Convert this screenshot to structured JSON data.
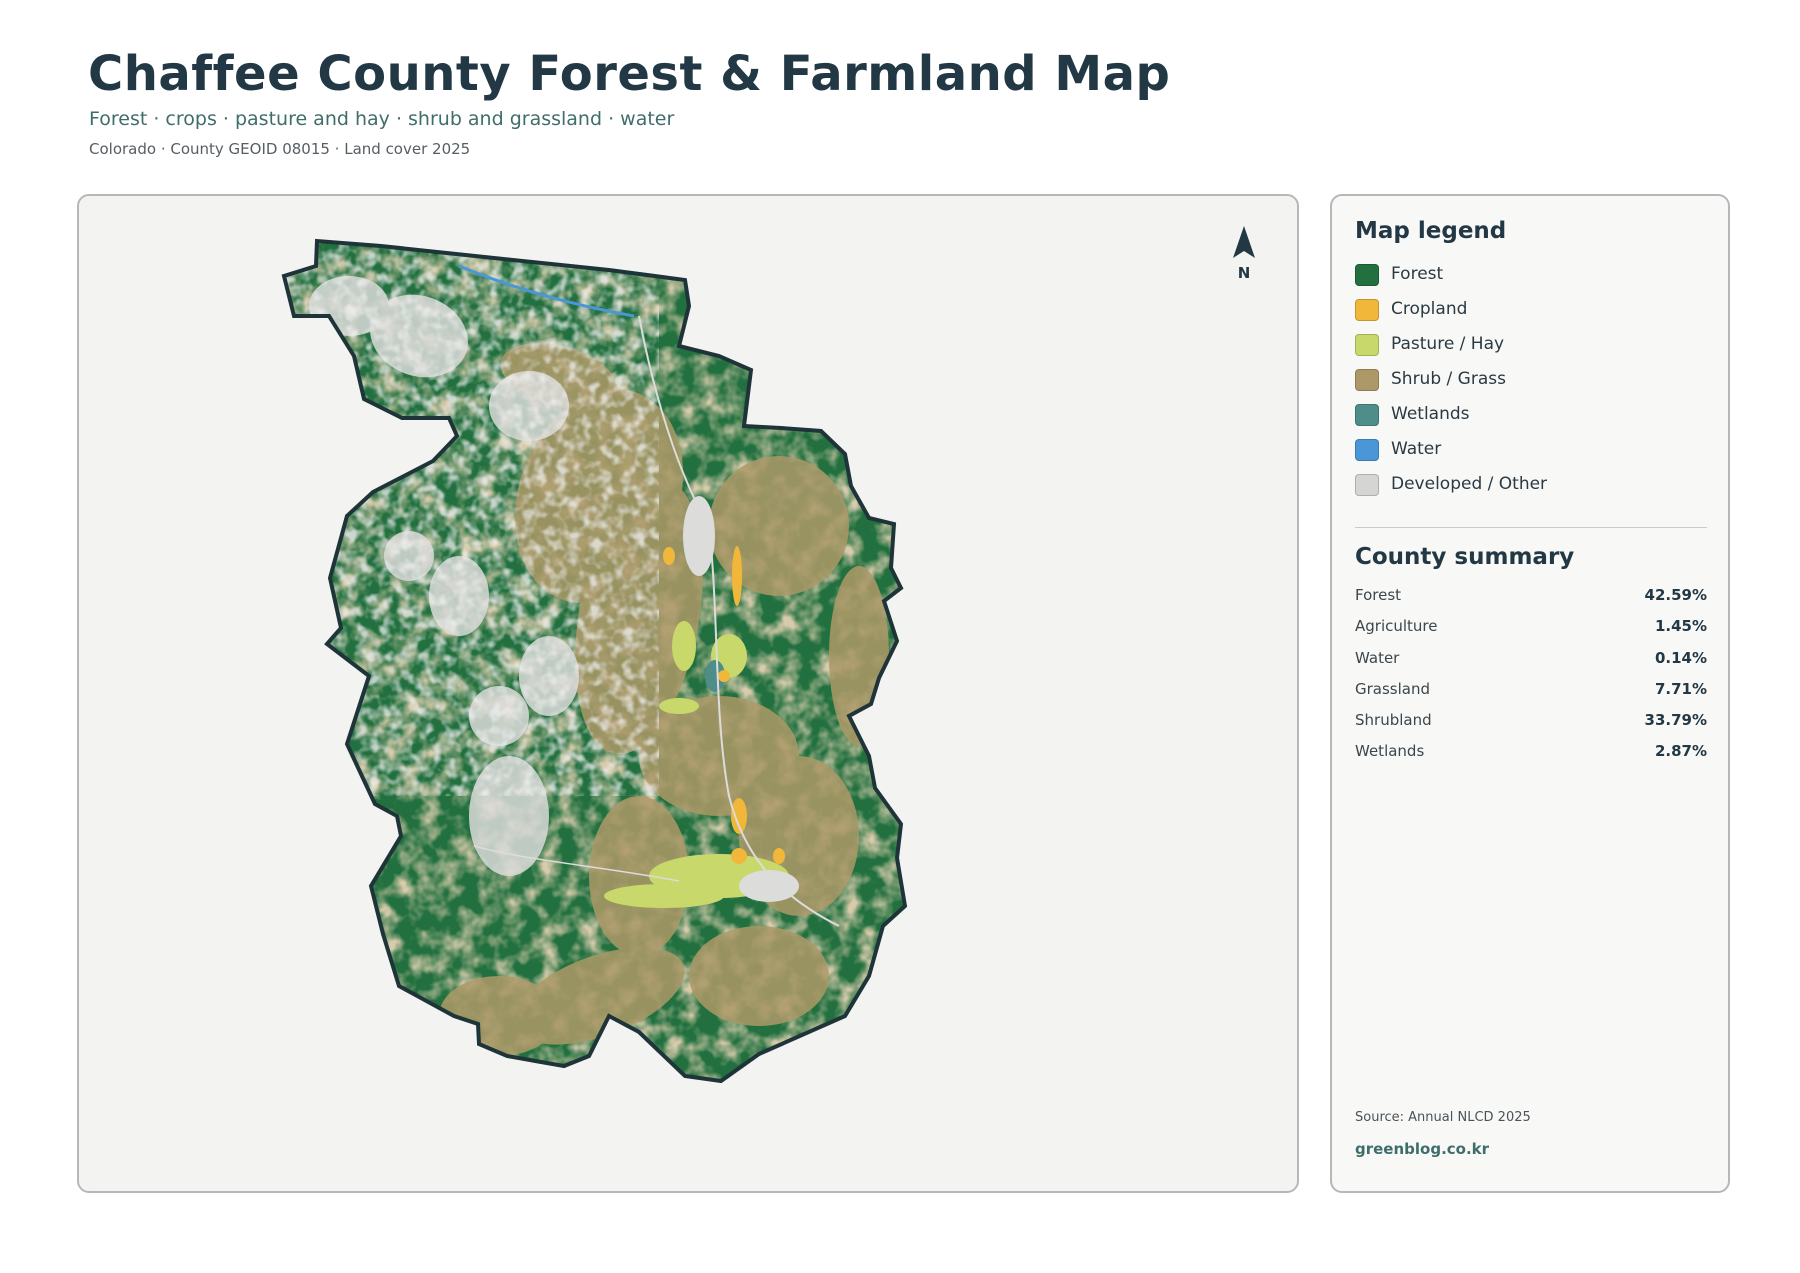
{
  "header": {
    "title": "Chaffee County Forest & Farmland Map",
    "subtitle": "Forest · crops · pasture and hay · shrub and grassland · water",
    "meta": "Colorado · County GEOID 08015 · Land cover 2025"
  },
  "map": {
    "north_label": "N",
    "colors": {
      "forest": "#22703f",
      "shrub": "#ad9968",
      "developed": "#dcdcdb",
      "pasture": "#c8d86a",
      "cropland": "#f0b73a",
      "wetlands": "#4e8d8a",
      "water": "#4a96d6",
      "outline": "#1f3438",
      "background": "#f3f3f2"
    }
  },
  "legend": {
    "title": "Map legend",
    "items": [
      {
        "label": "Forest",
        "color": "#22703f"
      },
      {
        "label": "Cropland",
        "color": "#f0b73a"
      },
      {
        "label": "Pasture / Hay",
        "color": "#c8d86a"
      },
      {
        "label": "Shrub / Grass",
        "color": "#ad9968"
      },
      {
        "label": "Wetlands",
        "color": "#4e8d8a"
      },
      {
        "label": "Water",
        "color": "#4a96d6"
      },
      {
        "label": "Developed / Other",
        "color": "#d5d5d4"
      }
    ]
  },
  "summary": {
    "title": "County summary",
    "rows": [
      {
        "label": "Forest",
        "value": "42.59%"
      },
      {
        "label": "Agriculture",
        "value": "1.45%"
      },
      {
        "label": "Water",
        "value": "0.14%"
      },
      {
        "label": "Grassland",
        "value": "7.71%"
      },
      {
        "label": "Shrubland",
        "value": "33.79%"
      },
      {
        "label": "Wetlands",
        "value": "2.87%"
      }
    ]
  },
  "footer": {
    "source": "Source: Annual NLCD 2025",
    "credit": "greenblog.co.kr"
  }
}
